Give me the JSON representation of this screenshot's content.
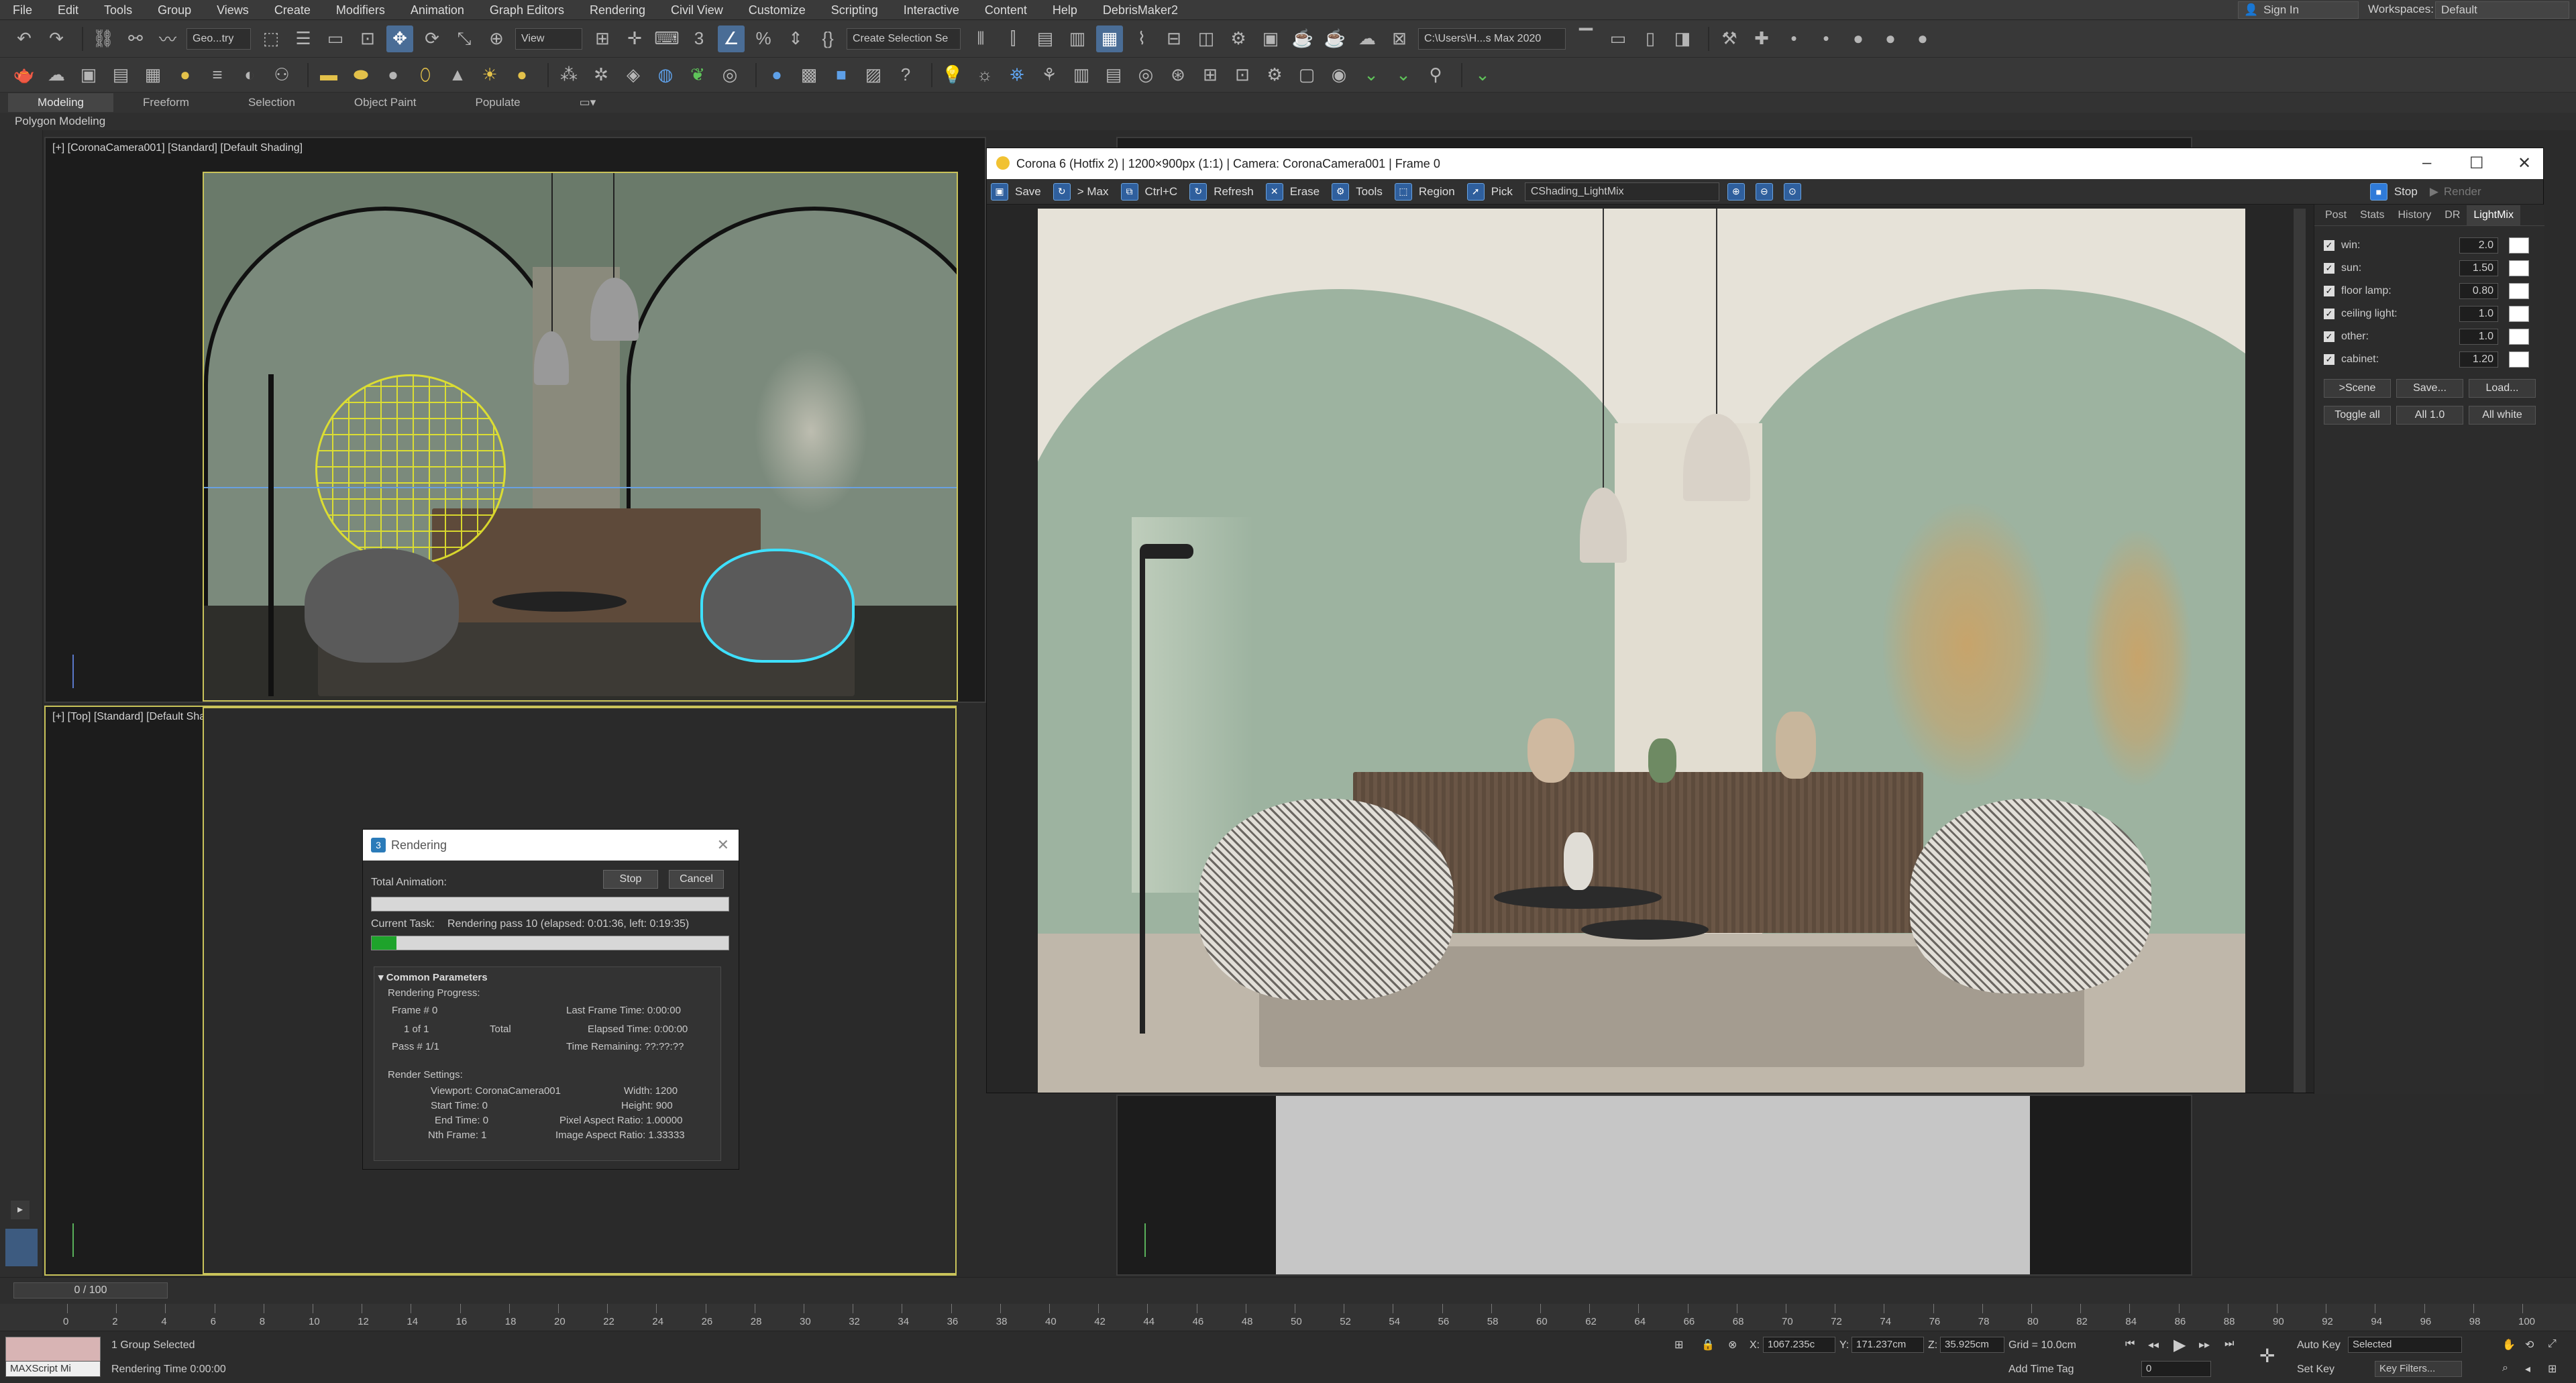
{
  "menu": [
    "File",
    "Edit",
    "Tools",
    "Group",
    "Views",
    "Create",
    "Modifiers",
    "Animation",
    "Graph Editors",
    "Rendering",
    "Civil View",
    "Customize",
    "Scripting",
    "Interactive",
    "Content",
    "Help",
    "DebrisMaker2"
  ],
  "account": {
    "signin": "Sign In",
    "workspace_label": "Workspaces:",
    "workspace_value": "Default"
  },
  "toolbar": {
    "selection_filter": "Geo...try",
    "ref_coord": "View",
    "named_selection": "Create Selection Se",
    "project_path": "C:\\Users\\H...s Max 2020"
  },
  "ribbon": {
    "tabs": [
      "Modeling",
      "Freeform",
      "Selection",
      "Object Paint",
      "Populate"
    ],
    "sub": "Polygon Modeling"
  },
  "viewports": {
    "camera_label": "[+] [CoronaCamera001] [Standard] [Default Shading]",
    "top_label": "[+] [Top] [Standard] [Default Shading]"
  },
  "corona": {
    "title": "Corona 6 (Hotfix 2) | 1200×900px (1:1) | Camera: CoronaCamera001 | Frame 0",
    "tools": [
      "Save",
      "> Max",
      "Ctrl+C",
      "Refresh",
      "Erase",
      "Tools",
      "Region",
      "Pick"
    ],
    "lightmix_preset": "CShading_LightMix",
    "stop": "Stop",
    "render": "Render",
    "panel_tabs": [
      "Post",
      "Stats",
      "History",
      "DR",
      "LightMix"
    ],
    "lights": [
      {
        "name": "win:",
        "value": "2.0"
      },
      {
        "name": "sun:",
        "value": "1.50"
      },
      {
        "name": "floor lamp:",
        "value": "0.80"
      },
      {
        "name": "ceiling light:",
        "value": "1.0"
      },
      {
        "name": "other:",
        "value": "1.0"
      },
      {
        "name": "cabinet:",
        "value": "1.20"
      }
    ],
    "buttons_row1": [
      ">Scene",
      "Save...",
      "Load..."
    ],
    "buttons_row2": [
      "Toggle all",
      "All 1.0",
      "All white"
    ]
  },
  "rendering_dialog": {
    "title": "Rendering",
    "total_animation": "Total Animation:",
    "stop": "Stop",
    "cancel": "Cancel",
    "current_task_label": "Current Task:",
    "current_task": "Rendering pass 10 (elapsed: 0:01:36, left: 0:19:35)",
    "progress": 0.07,
    "section": "Common Parameters",
    "rendering_progress": "Rendering Progress:",
    "frame": "Frame #  0",
    "of": "1 of 1",
    "total": "Total",
    "pass": "Pass #  1/1",
    "last_frame_time": "Last Frame Time:  0:00:00",
    "elapsed_time": "Elapsed Time:  0:00:00",
    "time_remaining": "Time Remaining:  ??:??:??",
    "render_settings": "Render Settings:",
    "viewport": "Viewport:  CoronaCamera001",
    "width": "Width:  1200",
    "start_time": "Start Time:  0",
    "height": "Height:  900",
    "end_time": "End Time:  0",
    "pixel_aspect": "Pixel Aspect Ratio:  1.00000",
    "nth_frame": "Nth Frame:  1",
    "image_aspect": "Image Aspect Ratio:  1.33333"
  },
  "timeline": {
    "frame_range": "0 / 100",
    "ticks": [
      "0",
      "2",
      "4",
      "6",
      "8",
      "10",
      "12",
      "14",
      "16",
      "18",
      "20",
      "22",
      "24",
      "26",
      "28",
      "30",
      "32",
      "34",
      "36",
      "38",
      "40",
      "42",
      "44",
      "46",
      "48",
      "50",
      "52",
      "54",
      "56",
      "58",
      "60",
      "62",
      "64",
      "66",
      "68",
      "70",
      "72",
      "74",
      "76",
      "78",
      "80",
      "82",
      "84",
      "86",
      "88",
      "90",
      "92",
      "94",
      "96",
      "98",
      "100"
    ]
  },
  "status": {
    "maxscript": "MAXScript Mi",
    "selected": "1 Group Selected",
    "render_time": "Rendering Time  0:00:00",
    "x": "1067.235c",
    "y": "171.237cm",
    "z": "35.925cm",
    "grid": "Grid = 10.0cm",
    "add_time_tag": "Add Time Tag",
    "auto_key": "Auto Key",
    "set_key": "Set Key",
    "selected_set": "Selected",
    "key_filters": "Key Filters...",
    "frame": "0"
  }
}
